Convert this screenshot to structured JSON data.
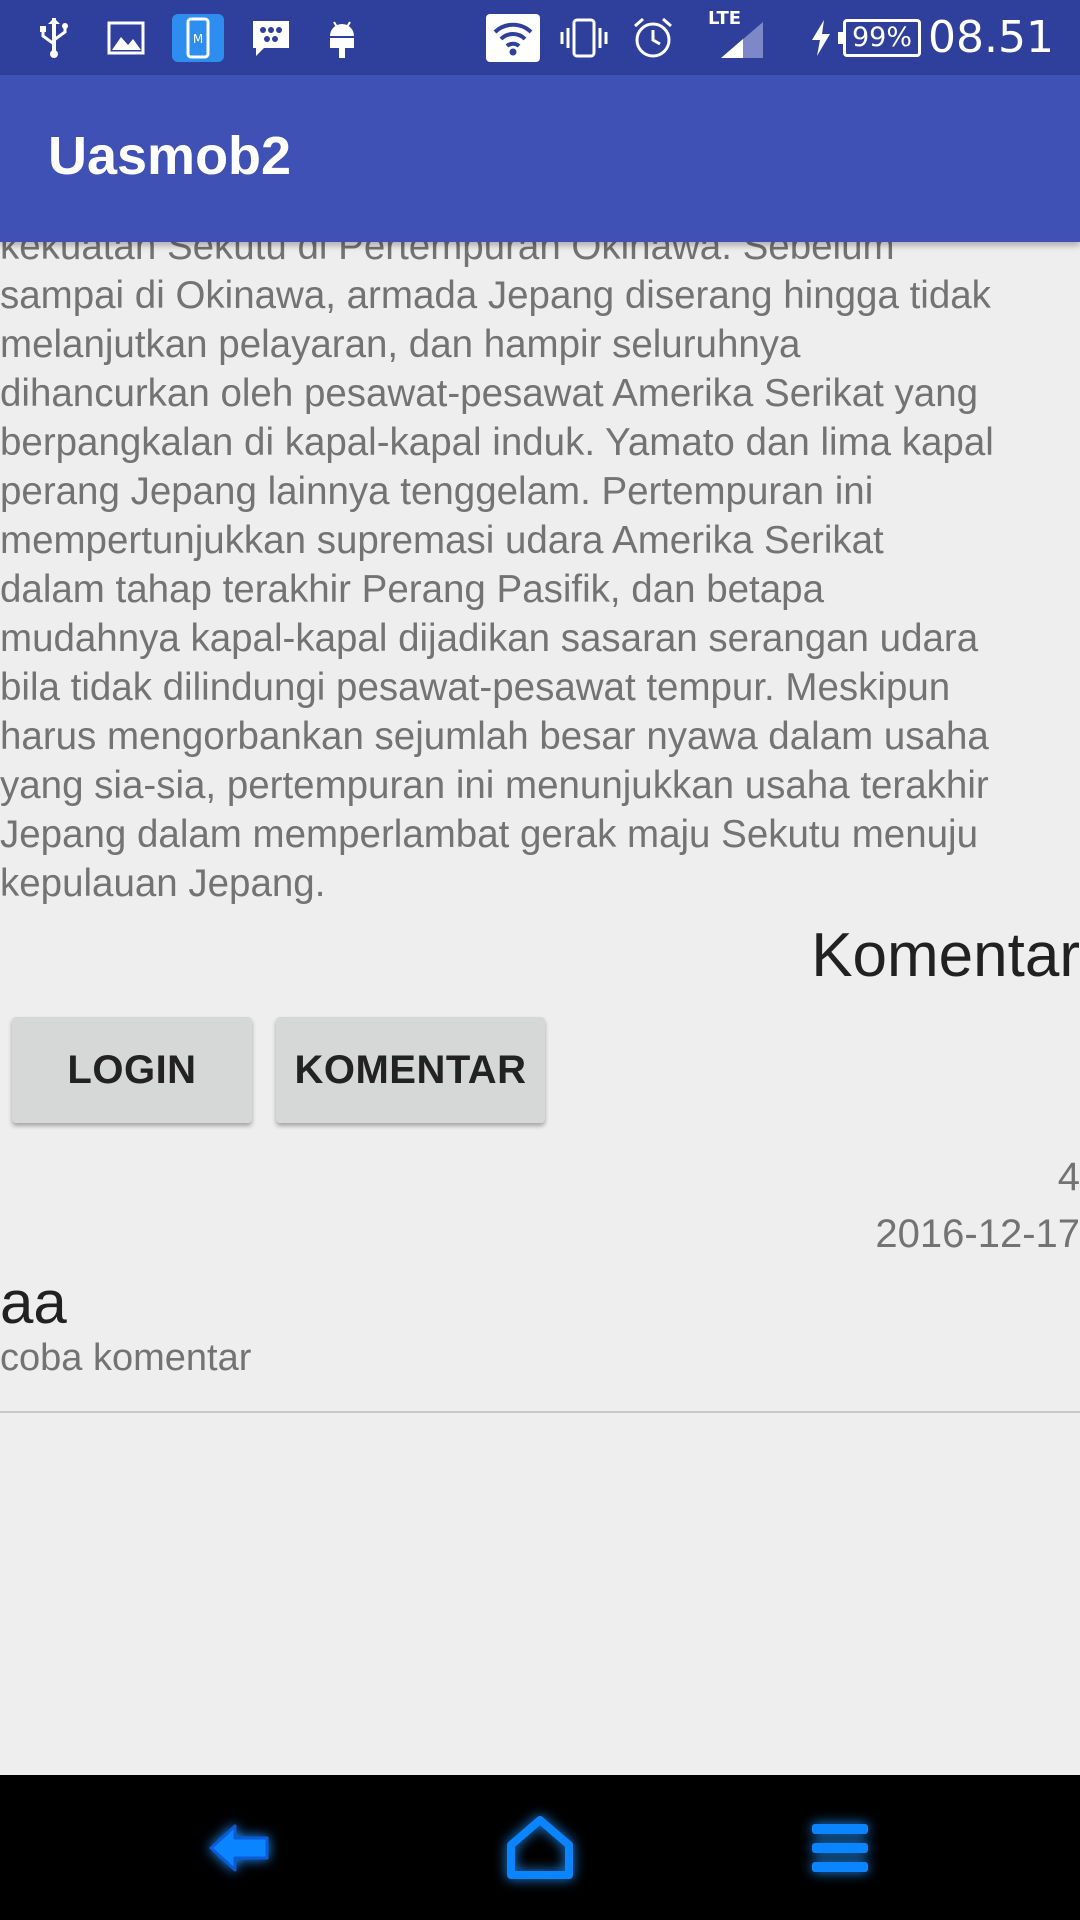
{
  "status_bar": {
    "time": "08.51",
    "battery": "99%",
    "network": "LTE",
    "icons": [
      "usb-icon",
      "gallery-icon",
      "mobile-app-icon",
      "bbm-icon",
      "android-icon",
      "wifi-icon",
      "vibrate-icon",
      "alarm-icon",
      "signal-icon",
      "charging-icon",
      "battery-icon"
    ]
  },
  "app_bar": {
    "title": "Uasmob2"
  },
  "article": {
    "lines": [
      "kekuatan Sekutu di Pertempuran Okinawa. Sebelum",
      "sampai di Okinawa, armada Jepang diserang hingga tidak",
      "melanjutkan pelayaran, dan hampir seluruhnya",
      "dihancurkan oleh pesawat-pesawat Amerika Serikat yang",
      "berpangkalan di kapal-kapal induk. Yamato dan lima kapal",
      "perang Jepang lainnya tenggelam. Pertempuran ini",
      "mempertunjukkan supremasi udara Amerika Serikat",
      "dalam tahap terakhir Perang Pasifik, dan betapa",
      "mudahnya kapal-kapal dijadikan sasaran serangan udara",
      "bila tidak dilindungi pesawat-pesawat tempur. Meskipun",
      "harus mengorbankan sejumlah besar nyawa dalam usaha",
      "yang sia-sia, pertempuran ini menunjukkan usaha terakhir",
      "Jepang dalam memperlambat gerak maju Sekutu menuju",
      "kepulauan Jepang."
    ]
  },
  "section": {
    "title": "Komentar"
  },
  "buttons": {
    "login": "LOGIN",
    "komentar": "KOMENTAR"
  },
  "comment": {
    "id": "4",
    "date": "2016-12-17",
    "name": "aa",
    "text": "coba komentar"
  },
  "nav_bar": {
    "icons": [
      "back-icon",
      "home-icon",
      "menu-icon"
    ],
    "accent": "#1e90ff"
  },
  "colors": {
    "status_bar": "#2f3f9c",
    "app_bar": "#3f51b5",
    "background": "#eeeeee",
    "button": "#d6d7d7"
  }
}
